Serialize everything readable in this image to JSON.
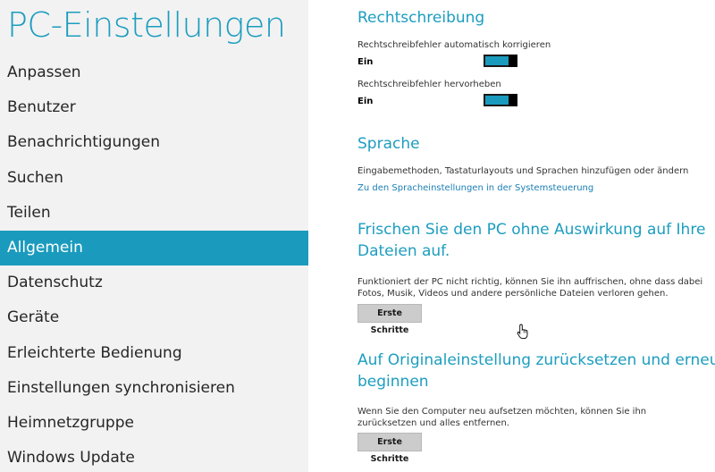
{
  "app_title": "PC-Einstellungen",
  "nav": {
    "items": [
      {
        "label": "Anpassen"
      },
      {
        "label": "Benutzer"
      },
      {
        "label": "Benachrichtigungen"
      },
      {
        "label": "Suchen"
      },
      {
        "label": "Teilen"
      },
      {
        "label": "Allgemein",
        "active": true
      },
      {
        "label": "Datenschutz"
      },
      {
        "label": "Geräte"
      },
      {
        "label": "Erleichterte Bedienung"
      },
      {
        "label": "Einstellungen synchronisieren"
      },
      {
        "label": "Heimnetzgruppe"
      },
      {
        "label": "Windows Update"
      }
    ]
  },
  "spelling": {
    "heading": "Rechtschreibung",
    "autocorrect_label": "Rechtschreibfehler automatisch korrigieren",
    "autocorrect_value": "Ein",
    "highlight_label": "Rechtschreibfehler hervorheben",
    "highlight_value": "Ein"
  },
  "language": {
    "heading": "Sprache",
    "description": "Eingabemethoden, Tastaturlayouts und Sprachen hinzufügen oder ändern",
    "link": "Zu den Spracheinstellungen in der Systemsteuerung"
  },
  "refresh": {
    "heading_line1": "Frischen Sie den PC ohne Auswirkung auf Ihre",
    "heading_line2": "Dateien auf.",
    "description": "Funktioniert der PC nicht richtig, können Sie ihn auffrischen, ohne dass dabei Fotos, Musik, Videos und andere persönliche Dateien verloren gehen.",
    "button": "Erste Schritte"
  },
  "reset": {
    "heading_line1": "Auf Originaleinstellung zurücksetzen und erneut",
    "heading_line2": "beginnen",
    "description": "Wenn Sie den Computer neu aufsetzen möchten, können Sie ihn zurücksetzen und alles entfernen.",
    "button": "Erste Schritte"
  },
  "colors": {
    "accent": "#1a9bbd",
    "sidebar_bg": "#f2f2f2",
    "link": "#1a7fb3"
  },
  "icons": {
    "cursor": "hand-pointer-icon"
  }
}
